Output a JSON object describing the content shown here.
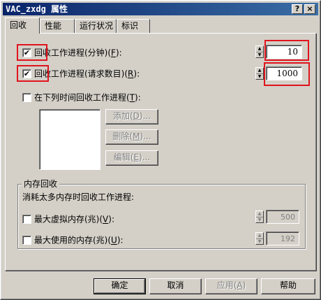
{
  "window": {
    "title": "VAC_zxdg 属性",
    "help_glyph": "?",
    "close_glyph": "×"
  },
  "tabs": [
    {
      "label": "回收"
    },
    {
      "label": "性能"
    },
    {
      "label": "运行状况"
    },
    {
      "label": "标识"
    }
  ],
  "recycle": {
    "minutes": {
      "label_pre": "回收工作进程(分钟)(",
      "accel": "F",
      "label_post": "):",
      "checked": true,
      "value": "10"
    },
    "requests": {
      "label_pre": "回收工作进程(请求数目)(",
      "accel": "R",
      "label_post": "):",
      "checked": true,
      "value": "1000"
    },
    "scheduled": {
      "label_pre": "在下列时间回收工作进程(",
      "accel": "T",
      "label_post": "):",
      "checked": false
    },
    "add_button": {
      "label_pre": "添加(",
      "accel": "D",
      "label_post": ")..."
    },
    "delete_button": {
      "label_pre": "删除(",
      "accel": "M",
      "label_post": ")..."
    },
    "edit_button": {
      "label_pre": "编辑(",
      "accel": "E",
      "label_post": ")..."
    }
  },
  "memory": {
    "group_title": "内存回收",
    "description": "消耗太多内存时回收工作进程:",
    "virtual": {
      "label_pre": "最大虚拟内存(兆)(",
      "accel": "V",
      "label_post": "):",
      "checked": false,
      "value": "500"
    },
    "used": {
      "label_pre": "最大使用的内存(兆)(",
      "accel": "U",
      "label_post": "):",
      "checked": false,
      "value": "192"
    }
  },
  "footer": {
    "ok": "确定",
    "cancel": "取消",
    "apply_pre": "应用(",
    "apply_accel": "A",
    "apply_post": ")",
    "help": "帮助"
  },
  "colors": {
    "title_start": "#0a246a",
    "title_end": "#3a6ea5",
    "highlight": "#e0141e",
    "face": "#d4d0c8"
  },
  "check_glyph": "✔"
}
